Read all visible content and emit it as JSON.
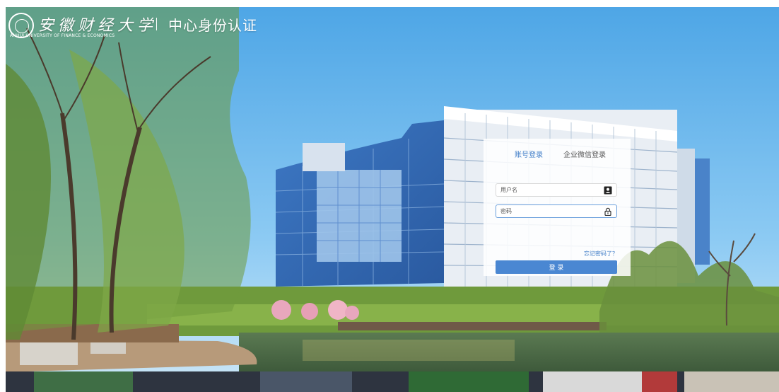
{
  "header": {
    "logo_name": "安徽财经大学",
    "logo_en": "ANHUI UNIVERSITY OF FINANCE & ECONOMICS",
    "title": "中心身份认证"
  },
  "login": {
    "tabs": [
      {
        "label": "账号登录",
        "active": true
      },
      {
        "label": "企业微信登录",
        "active": false
      }
    ],
    "username_placeholder": "用户名",
    "password_placeholder": "密码",
    "forgot_label": "忘记密码了？",
    "submit_label": "登 录"
  },
  "icons": {
    "username_field": "id-card-icon",
    "password_field": "lock-icon"
  },
  "colors": {
    "accent": "#4a87d2",
    "link": "#3d7bc7",
    "sky": "#62b2ea"
  }
}
